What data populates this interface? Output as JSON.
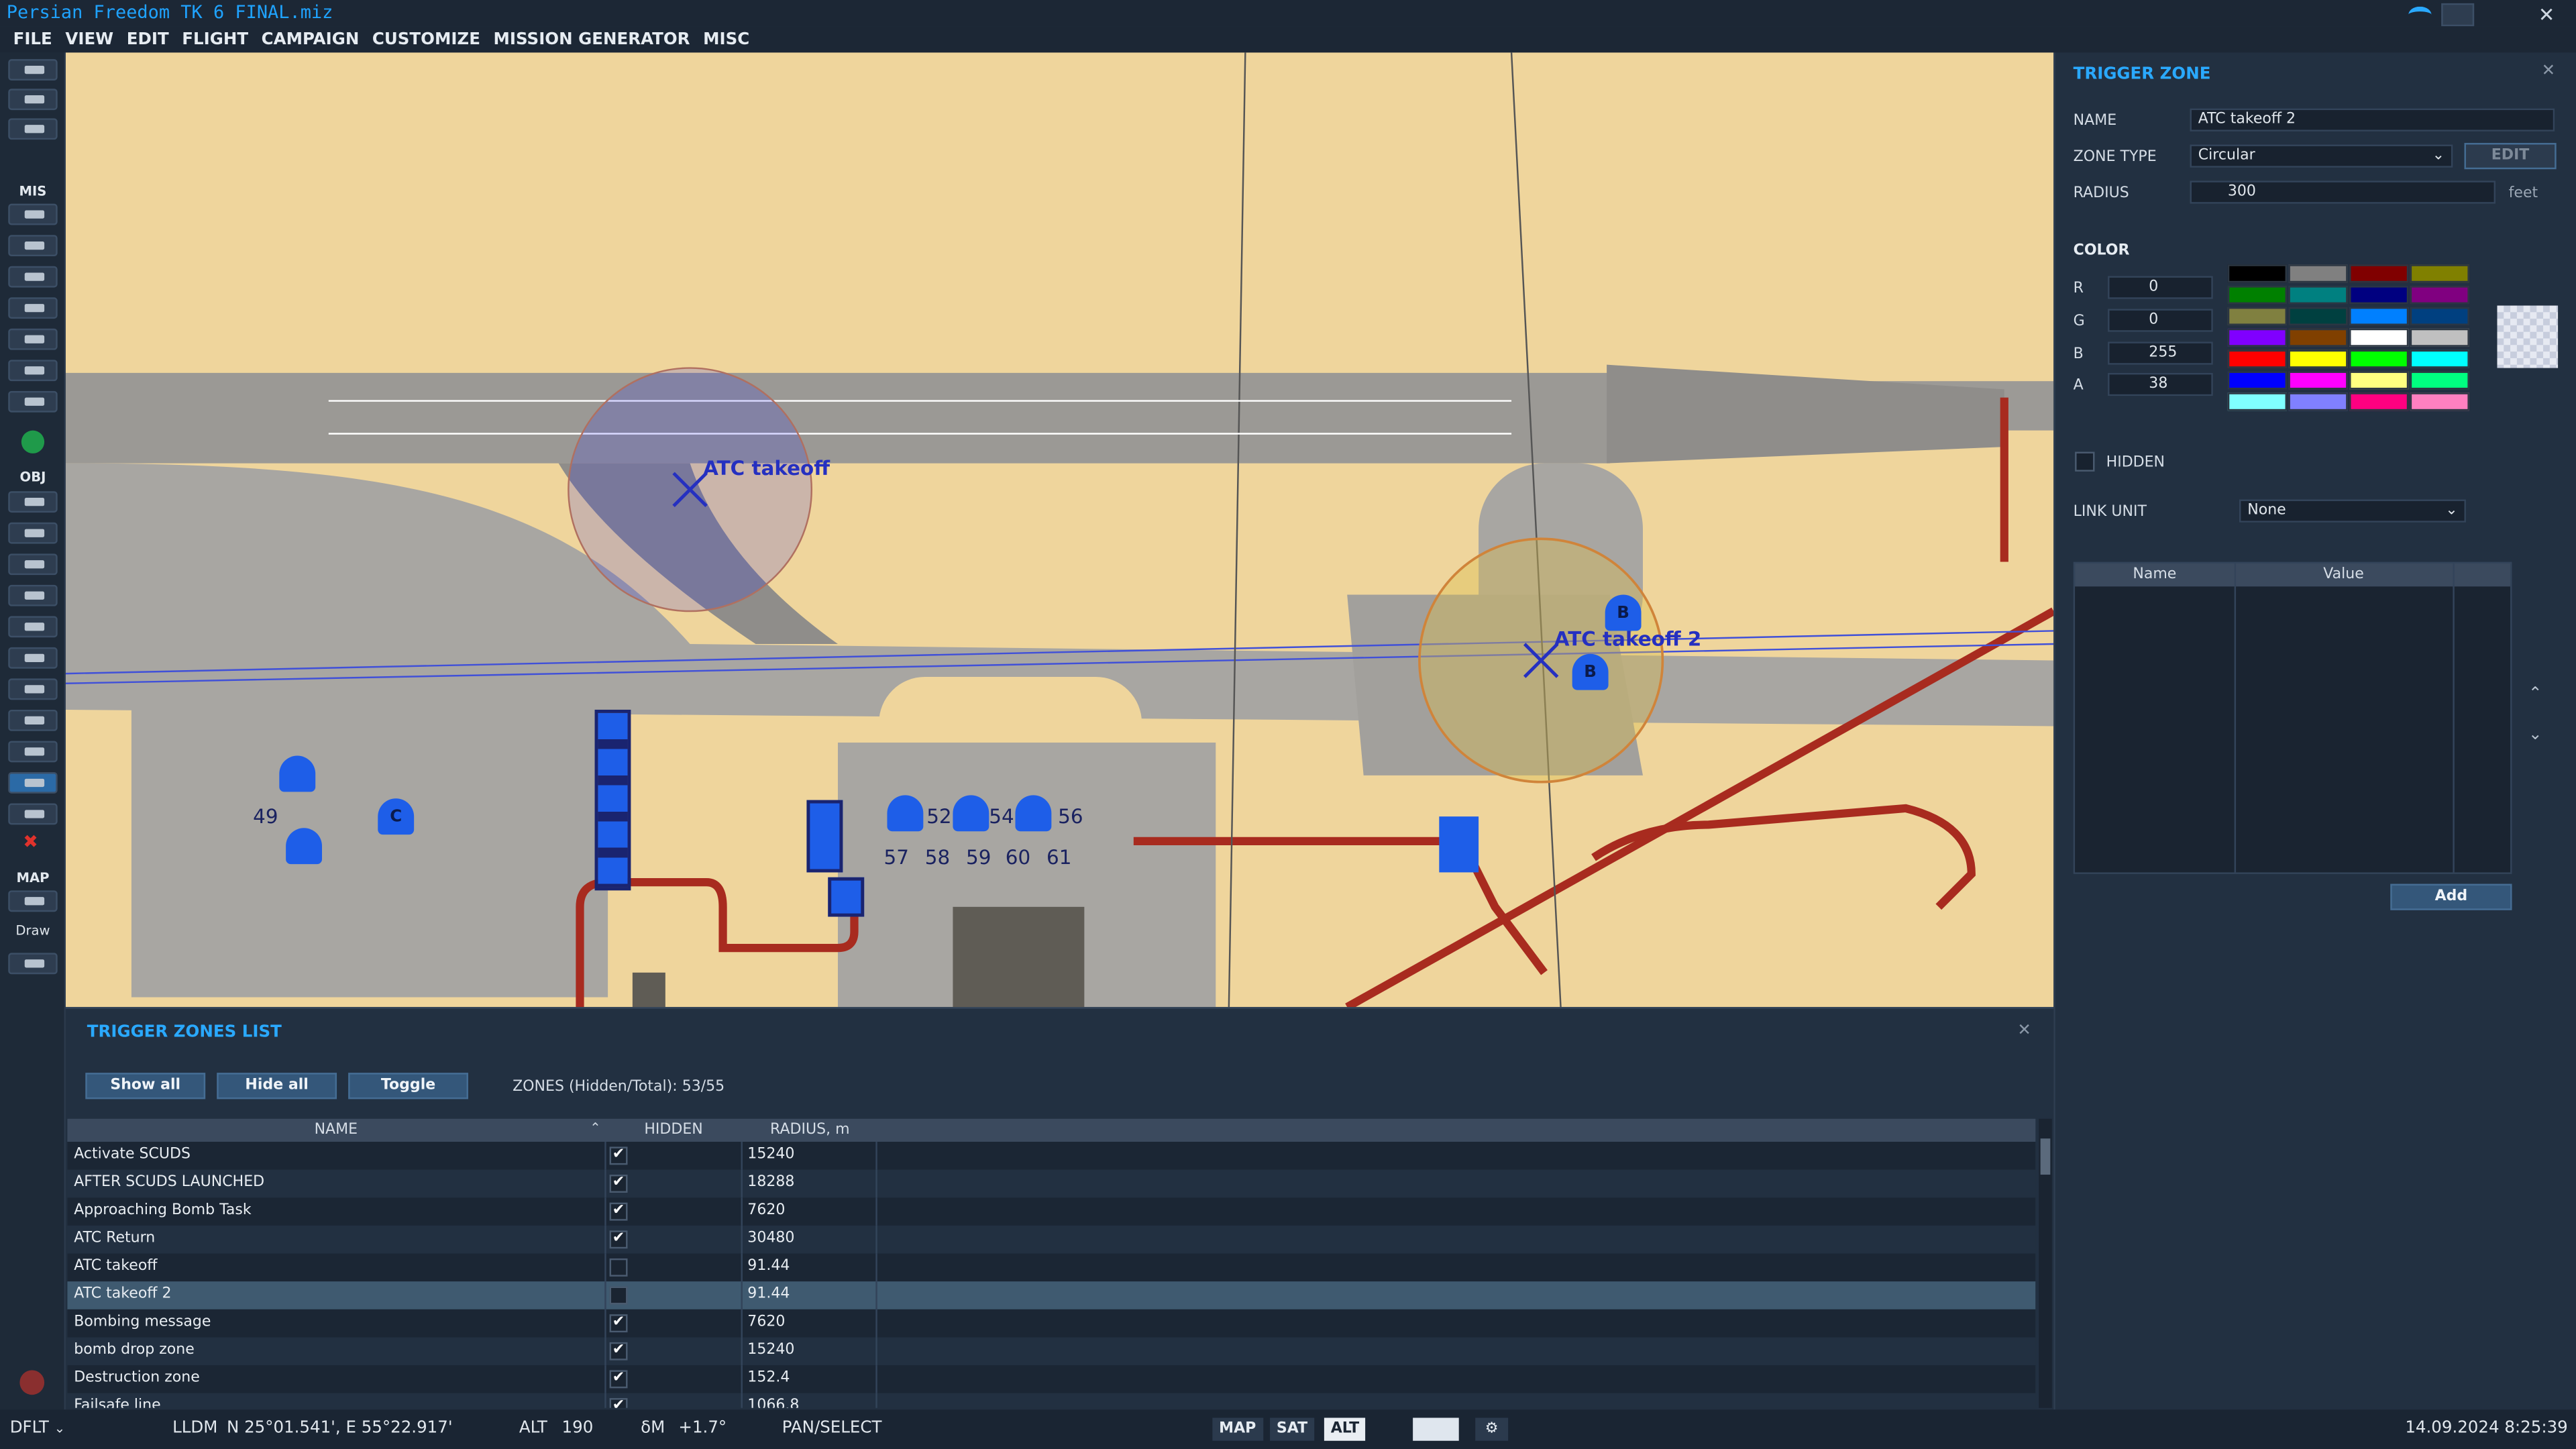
{
  "app": {
    "title": "Persian Freedom TK 6 FINAL.miz"
  },
  "menu": [
    "FILE",
    "VIEW",
    "EDIT",
    "FLIGHT",
    "CAMPAIGN",
    "CUSTOMIZE",
    "MISSION GENERATOR",
    "MISC"
  ],
  "toolbar": {
    "mis_label": "MIS",
    "obj_label": "OBJ",
    "map_label": "MAP",
    "draw_label": "Draw"
  },
  "map": {
    "zone1_label": "ATC takeoff",
    "zone2_label": "ATC takeoff 2",
    "parking_numbers": [
      "49",
      "52",
      "54",
      "56",
      "57",
      "58",
      "59",
      "60",
      "61"
    ],
    "markers": [
      "B",
      "B",
      "C"
    ]
  },
  "trigger_zone": {
    "title": "TRIGGER ZONE",
    "name_label": "NAME",
    "name_value": "ATC takeoff 2",
    "zone_type_label": "ZONE TYPE",
    "zone_type_value": "Circular",
    "edit_label": "EDIT",
    "radius_label": "RADIUS",
    "radius_value": "300",
    "radius_unit": "feet",
    "color_label": "COLOR",
    "r_label": "R",
    "r_value": "0",
    "g_label": "G",
    "g_value": "0",
    "b_label": "B",
    "b_value": "255",
    "a_label": "A",
    "a_value": "38",
    "palette": [
      "#000000",
      "#808080",
      "#800000",
      "#808000",
      "#008000",
      "#008080",
      "#000080",
      "#800080",
      "#808040",
      "#004040",
      "#0080ff",
      "#004080",
      "#8000ff",
      "#804000",
      "#ffffff",
      "#c0c0c0",
      "#ff0000",
      "#ffff00",
      "#00ff00",
      "#00ffff",
      "#0000ff",
      "#ff00ff",
      "#ffff80",
      "#00ff80",
      "#80ffff",
      "#8080ff",
      "#ff0080",
      "#ff80c0"
    ],
    "hidden_label": "HIDDEN",
    "link_unit_label": "LINK UNIT",
    "link_unit_value": "None",
    "prop_col_name": "Name",
    "prop_col_value": "Value",
    "add_label": "Add"
  },
  "zones_list": {
    "title": "TRIGGER ZONES LIST",
    "show_all": "Show all",
    "hide_all": "Hide all",
    "toggle": "Toggle",
    "count_text": "ZONES (Hidden/Total): 53/55",
    "col_name": "NAME",
    "col_hidden": "HIDDEN",
    "col_radius": "RADIUS, m",
    "rows": [
      {
        "name": "Activate SCUDS",
        "hidden": true,
        "radius": "15240"
      },
      {
        "name": "AFTER SCUDS LAUNCHED",
        "hidden": true,
        "radius": "18288"
      },
      {
        "name": "Approaching Bomb Task",
        "hidden": true,
        "radius": "7620"
      },
      {
        "name": "ATC Return",
        "hidden": true,
        "radius": "30480"
      },
      {
        "name": "ATC takeoff",
        "hidden": false,
        "radius": "91.44"
      },
      {
        "name": "ATC takeoff 2",
        "hidden": false,
        "radius": "91.44"
      },
      {
        "name": "Bombing message",
        "hidden": true,
        "radius": "7620"
      },
      {
        "name": "bomb drop zone",
        "hidden": true,
        "radius": "15240"
      },
      {
        "name": "Destruction zone",
        "hidden": true,
        "radius": "152.4"
      },
      {
        "name": "Failsafe line",
        "hidden": true,
        "radius": "1066.8"
      }
    ]
  },
  "status": {
    "profile": "DFLT",
    "coord_mode": "LLDM",
    "coords": "N 25°01.541', E 55°22.917'",
    "alt_label": "ALT",
    "alt_value": "190",
    "dm_label": "δM",
    "dm_value": "+1.7°",
    "mode": "PAN/SELECT",
    "map_btn": "MAP",
    "sat_btn": "SAT",
    "alt_btn": "ALT",
    "datetime": "14.09.2024 8:25:39"
  }
}
